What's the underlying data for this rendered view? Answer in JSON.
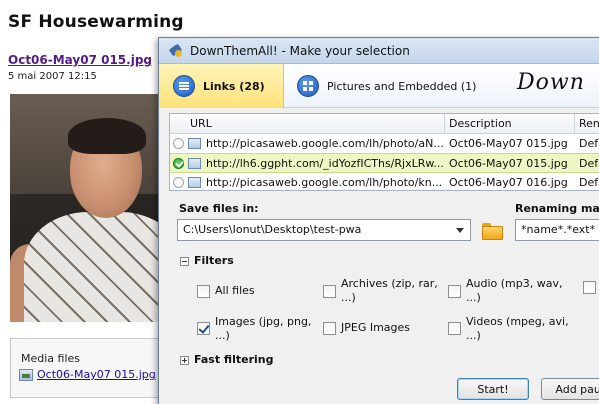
{
  "blog": {
    "title": "SF Housewarming",
    "post_link": "Oct06-May07 015.jpg",
    "post_date": "5 mai 2007 12:15",
    "media_title": "Media files",
    "media_link": "Oct06-May07 015.jpg"
  },
  "dialog": {
    "title": "DownThemAll! - Make your selection",
    "tabs": [
      {
        "label": "Links (28)",
        "icon": "list-icon",
        "active": true
      },
      {
        "label": "Pictures and Embedded (1)",
        "icon": "grid-icon",
        "active": false
      }
    ],
    "logo_text": "Down",
    "list": {
      "columns": [
        "URL",
        "Description",
        "Rena"
      ],
      "rows": [
        {
          "url": "http://picasaweb.google.com/lh/photo/aN...",
          "description": "Oct06-May07 015.jpg",
          "renaming": "Defa",
          "checked": false,
          "selected": false
        },
        {
          "url": "http://lh6.ggpht.com/_idYozfICThs/RjxLRw...",
          "description": "Oct06-May07 015.jpg",
          "renaming": "Defa",
          "checked": true,
          "selected": true
        },
        {
          "url": "http://picasaweb.google.com/lh/photo/kn...",
          "description": "Oct06-May07 016.jpg",
          "renaming": "Defa",
          "checked": false,
          "selected": false
        }
      ]
    },
    "save": {
      "label": "Save files in:",
      "path": "C:\\Users\\Ionut\\Desktop\\test-pwa",
      "mask_label": "Renaming mask",
      "mask_value": "*name*.*ext*"
    },
    "filters": {
      "label": "Filters",
      "options": [
        {
          "label": "All files",
          "checked": false
        },
        {
          "label": "Archives (zip, rar, ...)",
          "checked": false
        },
        {
          "label": "Audio (mp3, wav, ...)",
          "checked": false
        },
        {
          "label": "Images (jpg, png, ...)",
          "checked": true
        },
        {
          "label": "JPEG Images",
          "checked": false
        },
        {
          "label": "Videos (mpeg, avi, ...)",
          "checked": false
        }
      ]
    },
    "fast_filtering_label": "Fast filtering",
    "buttons": {
      "start": "Start!",
      "add_paused": "Add paus"
    }
  }
}
